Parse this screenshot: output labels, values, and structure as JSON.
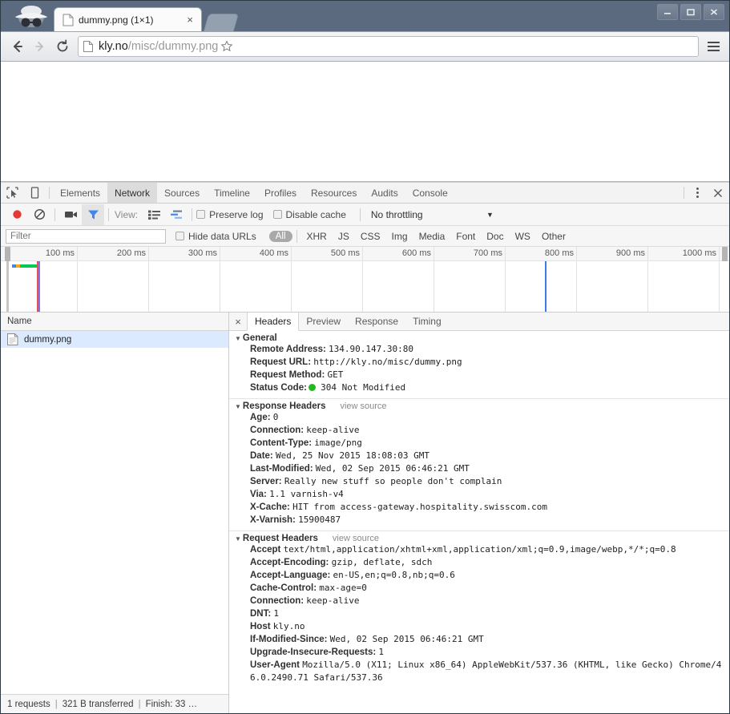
{
  "window": {
    "controls": [
      "minimize",
      "maximize",
      "close"
    ]
  },
  "tab": {
    "title": "dummy.png (1×1)",
    "close_label": "×",
    "favicon": "document-icon"
  },
  "omnibox": {
    "url_domain": "kly.no",
    "url_path": "/misc/dummy.png",
    "full_url": "kly.no/misc/dummy.png",
    "back_label": "←",
    "forward_label": "→",
    "reload_label": "C"
  },
  "devtools": {
    "tabs": [
      {
        "label": "Elements",
        "active": false
      },
      {
        "label": "Network",
        "active": true
      },
      {
        "label": "Sources",
        "active": false
      },
      {
        "label": "Timeline",
        "active": false
      },
      {
        "label": "Profiles",
        "active": false
      },
      {
        "label": "Resources",
        "active": false
      },
      {
        "label": "Audits",
        "active": false
      },
      {
        "label": "Console",
        "active": false
      }
    ],
    "toolbar": {
      "view_label": "View:",
      "preserve_log": "Preserve log",
      "disable_cache": "Disable cache",
      "throttling": "No throttling",
      "throttling_caret": "▼"
    },
    "filterbar": {
      "filter_placeholder": "Filter",
      "filter_value": "",
      "hide_data_urls": "Hide data URLs",
      "pill_all": "All",
      "types": [
        "XHR",
        "JS",
        "CSS",
        "Img",
        "Media",
        "Font",
        "Doc",
        "WS",
        "Other"
      ]
    },
    "overview": {
      "ticks": [
        "100 ms",
        "200 ms",
        "300 ms",
        "400 ms",
        "500 ms",
        "600 ms",
        "700 ms",
        "800 ms",
        "900 ms",
        "1000 ms"
      ]
    },
    "requests": {
      "column_header": "Name",
      "rows": [
        {
          "name": "dummy.png",
          "selected": true
        }
      ]
    },
    "statusbar": {
      "requests": "1 requests",
      "transferred": "321 B transferred",
      "finish": "Finish: 33 …",
      "sep": "|"
    },
    "details": {
      "close_label": "×",
      "tabs": [
        {
          "label": "Headers",
          "active": true
        },
        {
          "label": "Preview",
          "active": false
        },
        {
          "label": "Response",
          "active": false
        },
        {
          "label": "Timing",
          "active": false
        }
      ],
      "sections": [
        {
          "title": "General",
          "view_source": "",
          "rows": [
            {
              "name": "Remote Address:",
              "value": "134.90.147.30:80"
            },
            {
              "name": "Request URL:",
              "value": "http://kly.no/misc/dummy.png"
            },
            {
              "name": "Request Method:",
              "value": "GET"
            },
            {
              "name": "Status Code:",
              "value": "304 Not Modified",
              "dot": true
            }
          ]
        },
        {
          "title": "Response Headers",
          "view_source": "view source",
          "rows": [
            {
              "name": "Age:",
              "value": "0"
            },
            {
              "name": "Connection:",
              "value": "keep-alive"
            },
            {
              "name": "Content-Type:",
              "value": "image/png"
            },
            {
              "name": "Date:",
              "value": "Wed, 25 Nov 2015 18:08:03 GMT"
            },
            {
              "name": "Last-Modified:",
              "value": "Wed, 02 Sep 2015 06:46:21 GMT"
            },
            {
              "name": "Server:",
              "value": "Really new stuff so people don't complain"
            },
            {
              "name": "Via:",
              "value": "1.1 varnish-v4"
            },
            {
              "name": "X-Cache:",
              "value": "HIT from access-gateway.hospitality.swisscom.com"
            },
            {
              "name": "X-Varnish:",
              "value": "15900487"
            }
          ]
        },
        {
          "title": "Request Headers",
          "view_source": "view source",
          "rows": [
            {
              "name": "Accept",
              "value": "text/html,application/xhtml+xml,application/xml;q=0.9,image/webp,*/*;q=0.8"
            },
            {
              "name": "Accept-Encoding:",
              "value": "gzip, deflate, sdch"
            },
            {
              "name": "Accept-Language:",
              "value": "en-US,en;q=0.8,nb;q=0.6"
            },
            {
              "name": "Cache-Control:",
              "value": "max-age=0"
            },
            {
              "name": "Connection:",
              "value": "keep-alive"
            },
            {
              "name": "DNT:",
              "value": "1"
            },
            {
              "name": "Host",
              "value": "kly.no"
            },
            {
              "name": "If-Modified-Since:",
              "value": "Wed, 02 Sep 2015 06:46:21 GMT"
            },
            {
              "name": "Upgrade-Insecure-Requests:",
              "value": "1"
            },
            {
              "name": "User-Agent",
              "value": "Mozilla/5.0 (X11; Linux x86_64) AppleWebKit/537.36 (KHTML, like Gecko) Chrome/46.0.2490.71 Safari/537.36"
            }
          ]
        }
      ]
    }
  },
  "colors": {
    "record_red": "#e53935",
    "filter_blue": "#3b89f0",
    "selection_blue": "#dbeafe",
    "status_green": "#23b923",
    "event_blue": "#3b7de0",
    "event_red": "#e05252",
    "bar_green": "#00c853",
    "bar_orange": "#f5a623"
  }
}
